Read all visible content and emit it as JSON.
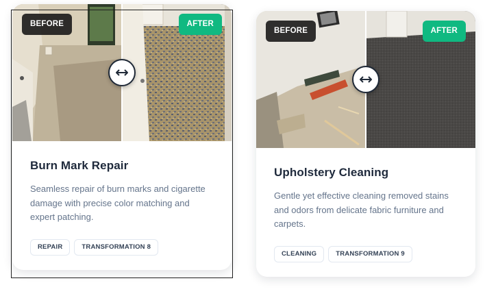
{
  "cards": [
    {
      "before_label": "BEFORE",
      "after_label": "AFTER",
      "title": "Burn Mark Repair",
      "description": "Seamless repair of burn marks and cigarette damage with precise color matching and expert patching.",
      "tags": [
        "REPAIR",
        "TRANSFORMATION 8"
      ]
    },
    {
      "before_label": "BEFORE",
      "after_label": "AFTER",
      "title": "Upholstery Cleaning",
      "description": "Gentle yet effective cleaning removed stains and odors from delicate fabric furniture and carpets.",
      "tags": [
        "CLEANING",
        "TRANSFORMATION 9"
      ]
    }
  ],
  "colors": {
    "after_badge": "#10b981",
    "before_badge": "#141414",
    "title": "#1e293b",
    "description": "#64748b"
  },
  "icons": {
    "handle": "left-right-arrows-icon"
  }
}
